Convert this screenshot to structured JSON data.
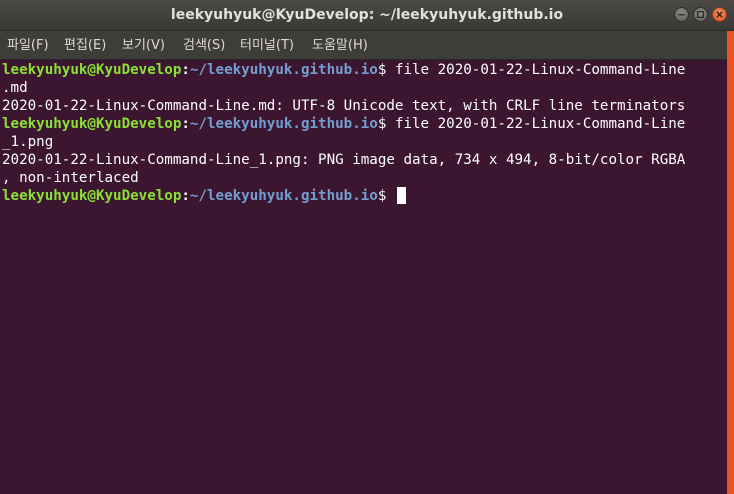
{
  "window": {
    "title": "leekyuhyuk@KyuDevelop: ~/leekyuhyuk.github.io",
    "controls": [
      "minimize-icon",
      "maximize-icon",
      "close-icon"
    ]
  },
  "menubar": {
    "items": [
      "파일(F)",
      "편집(E)",
      "보기(V)",
      "검색(S)",
      "터미널(T)",
      "도움말(H)"
    ]
  },
  "terminal": {
    "prompt": {
      "user_host": "leekyuhyuk@KyuDevelop",
      "colon": ":",
      "path": "~/leekyuhyuk.github.io",
      "dollar": "$ "
    },
    "lines": [
      {
        "command": "file 2020-01-22-Linux-Command-Line"
      },
      {
        "text": ".md"
      },
      {
        "text": "2020-01-22-Linux-Command-Line.md: UTF-8 Unicode text, with CRLF line terminators"
      },
      {
        "command": "file 2020-01-22-Linux-Command-Line"
      },
      {
        "text": "_1.png"
      },
      {
        "text": "2020-01-22-Linux-Command-Line_1.png: PNG image data, 734 x 494, 8-bit/color RGBA"
      },
      {
        "text": ", non-interlaced"
      }
    ]
  },
  "colors": {
    "background": "#3c1530",
    "prompt_user": "#8ae234",
    "prompt_path": "#729fcf",
    "accent": "#e95420"
  }
}
